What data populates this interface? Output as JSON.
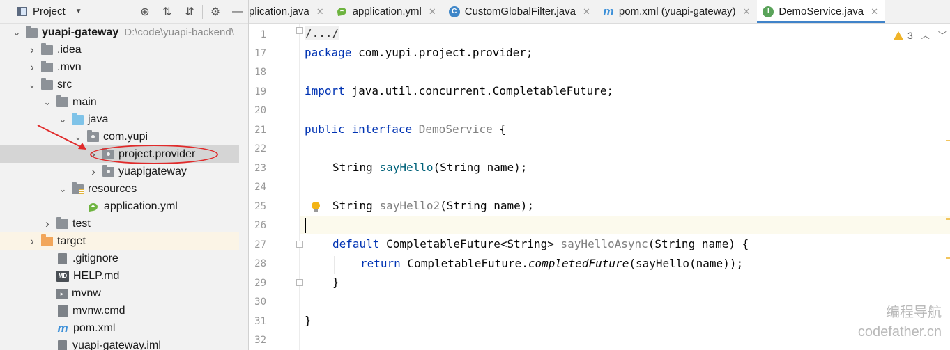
{
  "project_panel": {
    "title": "Project",
    "tools": [
      "locate-icon",
      "expand-all-icon",
      "collapse-all-icon",
      "gear-icon",
      "hide-icon"
    ],
    "tree": [
      {
        "label": "yuapi-gateway",
        "path": "D:\\code\\yuapi-backend\\",
        "bold": true,
        "indent": 0,
        "arrow": "expanded",
        "icon": "folder"
      },
      {
        "label": ".idea",
        "indent": 1,
        "arrow": "collapsed",
        "icon": "folder"
      },
      {
        "label": ".mvn",
        "indent": 1,
        "arrow": "collapsed",
        "icon": "folder"
      },
      {
        "label": "src",
        "indent": 1,
        "arrow": "expanded",
        "icon": "folder"
      },
      {
        "label": "main",
        "indent": 2,
        "arrow": "expanded",
        "icon": "folder"
      },
      {
        "label": "java",
        "indent": 3,
        "arrow": "expanded",
        "icon": "folder-blue"
      },
      {
        "label": "com.yupi",
        "indent": 4,
        "arrow": "expanded",
        "icon": "package"
      },
      {
        "label": "project.provider",
        "indent": 5,
        "arrow": "collapsed",
        "icon": "package",
        "selected": true
      },
      {
        "label": "yuapigateway",
        "indent": 5,
        "arrow": "collapsed",
        "icon": "package"
      },
      {
        "label": "resources",
        "indent": 3,
        "arrow": "expanded",
        "icon": "resources"
      },
      {
        "label": "application.yml",
        "indent": 4,
        "arrow": "none",
        "icon": "yml"
      },
      {
        "label": "test",
        "indent": 2,
        "arrow": "collapsed",
        "icon": "folder"
      },
      {
        "label": "target",
        "indent": 1,
        "arrow": "collapsed",
        "icon": "folder-orange",
        "highlight": true
      },
      {
        "label": ".gitignore",
        "indent": 2,
        "arrow": "none",
        "icon": "file"
      },
      {
        "label": "HELP.md",
        "indent": 2,
        "arrow": "none",
        "icon": "md"
      },
      {
        "label": "mvnw",
        "indent": 2,
        "arrow": "none",
        "icon": "mvnw"
      },
      {
        "label": "mvnw.cmd",
        "indent": 2,
        "arrow": "none",
        "icon": "cmd"
      },
      {
        "label": "pom.xml",
        "indent": 2,
        "arrow": "none",
        "icon": "m"
      },
      {
        "label": "yuapi-gateway.iml",
        "indent": 2,
        "arrow": "none",
        "icon": "file"
      }
    ]
  },
  "editor": {
    "tabs": [
      {
        "label": "plication.java",
        "icon": "none",
        "active": false
      },
      {
        "label": "application.yml",
        "icon": "yml",
        "active": false
      },
      {
        "label": "CustomGlobalFilter.java",
        "icon": "class-c",
        "active": false
      },
      {
        "label": "pom.xml (yuapi-gateway)",
        "icon": "m",
        "active": false
      },
      {
        "label": "DemoService.java",
        "icon": "iface-i",
        "active": true
      }
    ],
    "inspection": {
      "warnings": "3"
    },
    "line_numbers": [
      "1",
      "17",
      "18",
      "19",
      "20",
      "21",
      "22",
      "23",
      "24",
      "25",
      "26",
      "27",
      "28",
      "29",
      "30",
      "31",
      "32"
    ],
    "code": {
      "l1": "/.../",
      "l17_kw": "package",
      "l17_rest": " com.yupi.project.provider;",
      "l19_kw": "import",
      "l19_rest": " java.util.concurrent.CompletableFuture;",
      "l21_kw1": "public",
      "l21_kw2": "interface",
      "l21_name": "DemoService",
      "l21_brace": " {",
      "l23_type": "String ",
      "l23_method": "sayHello",
      "l23_params": "(String name);",
      "l25_type": "String ",
      "l25_method": "sayHello2",
      "l25_params": "(String name);",
      "l27_kw": "default",
      "l27_type": " CompletableFuture<String> ",
      "l27_method": "sayHelloAsync",
      "l27_params": "(String name) {",
      "l28_kw": "return",
      "l28_cls": " CompletableFuture.",
      "l28_method": "completedFuture",
      "l28_args": "(sayHello(name));",
      "l29": "}",
      "l31": "}"
    }
  },
  "watermark": {
    "line1": "编程导航",
    "line2": "codefather.cn"
  }
}
